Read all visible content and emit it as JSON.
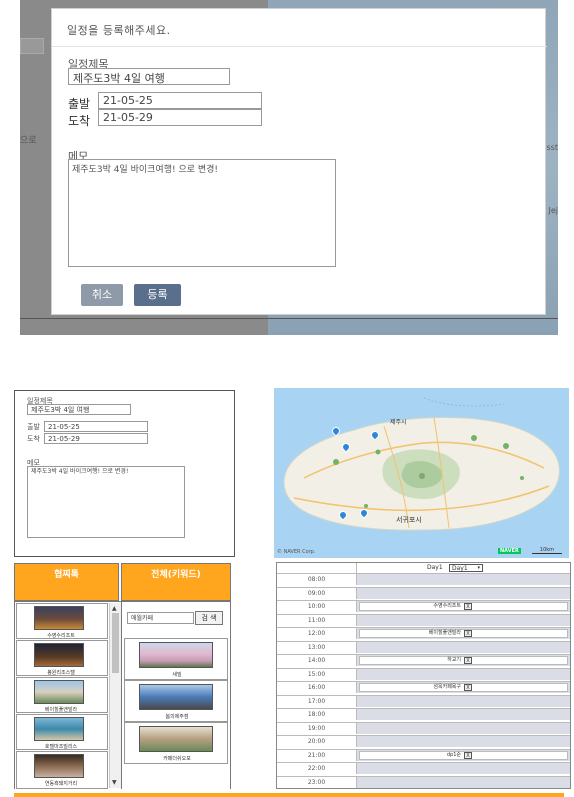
{
  "modal": {
    "title": "일정을 등록해주세요.",
    "title_label": "일정제목",
    "title_value": "제주도3박 4일 여행",
    "depart_label": "출발",
    "depart_value": "21-05-25",
    "arrive_label": "도착",
    "arrive_value": "21-05-29",
    "memo_label": "메모",
    "memo_value": "제주도3박 4일 바이크여행! 으로 변경!",
    "cancel_label": "취소",
    "submit_label": "등록",
    "bg_text_left": "으로",
    "bg_text_right": "sst",
    "bg_text_right2": "Jej"
  },
  "form": {
    "title_label": "일정제목",
    "title_value": "제주도3박 4일 여행",
    "depart_label": "출발",
    "depart_value": "21-05-25",
    "arrive_label": "도착",
    "arrive_value": "21-05-29",
    "memo_label": "메모",
    "memo_value": "제주도3박 4일 바이크여행! 으로 변경!"
  },
  "tabs": {
    "left": "협찌톡",
    "right": "전체(키워드)"
  },
  "left_list": [
    {
      "caption": "수영수리조트"
    },
    {
      "caption": "봉원리조스텔"
    },
    {
      "caption": "베이힐풀앤빌라"
    },
    {
      "caption": "호텔마조빌리스"
    },
    {
      "caption": "연동흑돼지거리"
    }
  ],
  "search": {
    "value": "애월카페",
    "button_label": "검 색"
  },
  "right_list": [
    {
      "caption": "새빌"
    },
    {
      "caption": "봄의제주점"
    },
    {
      "caption": "카페더쉬오포"
    }
  ],
  "map": {
    "city1": "제주시",
    "city2": "서귀포시",
    "copyright": "© NAVER Corp.",
    "logo": "NAVER",
    "scale": "10km"
  },
  "schedule": {
    "day_label": "Day1",
    "day_select": "Day1",
    "times": [
      "08:00",
      "09:00",
      "10:00",
      "11:00",
      "12:00",
      "13:00",
      "14:00",
      "15:00",
      "16:00",
      "17:00",
      "18:00",
      "19:00",
      "20:00",
      "21:00",
      "22:00",
      "23:00"
    ],
    "events": {
      "10:00": "수영수리조트",
      "12:00": "베이힐풀앤빌라",
      "14:00": "하교기",
      "16:00": "섬옥카페욕구",
      "21:00": "dp1순"
    },
    "remove_label": "X"
  },
  "colors": {
    "accent": "#ffa51e",
    "button_dark": "#5a6f8c",
    "button_gray": "#8e9aa8"
  }
}
